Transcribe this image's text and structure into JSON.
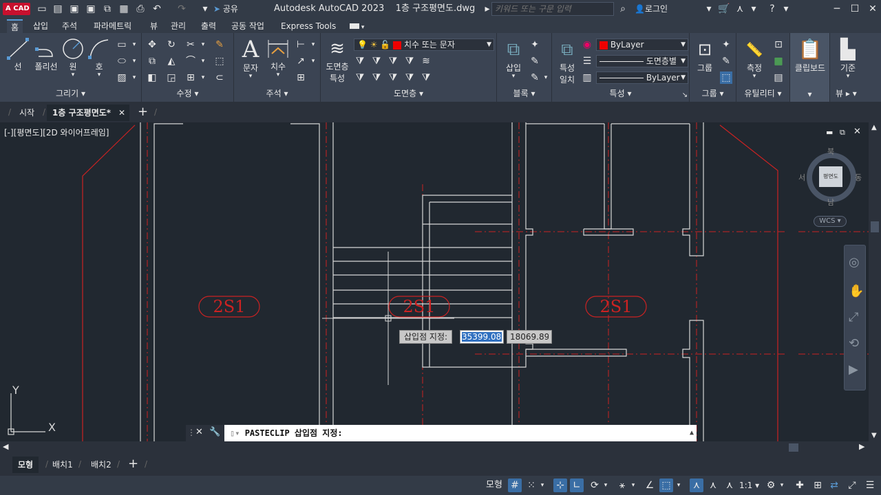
{
  "app": {
    "logo": "CAD",
    "title": "Autodesk AutoCAD 2023",
    "filename": "1층 구조평면도.dwg",
    "share_label": "공유",
    "search_placeholder": "키워드 또는 구문 입력",
    "login_label": "로그인"
  },
  "ribbon_tabs": [
    "홈",
    "삽입",
    "주석",
    "파라메트릭",
    "뷰",
    "관리",
    "출력",
    "공동 작업",
    "Express Tools"
  ],
  "draw": {
    "line": "선",
    "polyline": "폴리선",
    "circle": "원",
    "arc": "호",
    "title": "그리기"
  },
  "modify": {
    "title": "수정"
  },
  "annotation": {
    "text": "문자",
    "dim": "치수",
    "title": "주석"
  },
  "layers": {
    "props_line1": "도면층",
    "props_line2": "특성",
    "current": "치수 또는 문자",
    "title": "도면층"
  },
  "block": {
    "insert": "삽입",
    "title": "블록"
  },
  "properties": {
    "match_line1": "특성",
    "match_line2": "일치",
    "color": "ByLayer",
    "linetype": "도면층별",
    "lineweight": "ByLayer",
    "title": "특성"
  },
  "groups": {
    "group": "그룹",
    "title": "그룹"
  },
  "utilities": {
    "measure": "측정",
    "title": "유틸리티"
  },
  "clipboard": {
    "label": "클립보드"
  },
  "view": {
    "base": "기준",
    "title": "뷰"
  },
  "doc_tabs": {
    "start": "시작",
    "active": "1층 구조평면도*"
  },
  "viewport": {
    "label": "[-][평면도][2D 와이어프레임]",
    "viewcube": {
      "north": "북",
      "south": "남",
      "east": "동",
      "west": "서",
      "face": "평면도",
      "wcs": "WCS"
    },
    "tags": [
      "2S1",
      "2S1",
      "2S1"
    ],
    "prompt": {
      "label": "삽입점 지정:",
      "x": "35399.08",
      "y": "18069.89"
    },
    "ucs_x": "X",
    "ucs_y": "Y"
  },
  "command": {
    "text": "PASTECLIP 삽입점 지정:"
  },
  "layout_tabs": [
    "모형",
    "배치1",
    "배치2"
  ],
  "status": {
    "model": "모형",
    "scale": "1:1"
  },
  "colors": {
    "accent": "#5a9bd5",
    "drawing_red": "#cc2222",
    "drawing_white": "#d8d8d8",
    "bg": "#212830"
  }
}
